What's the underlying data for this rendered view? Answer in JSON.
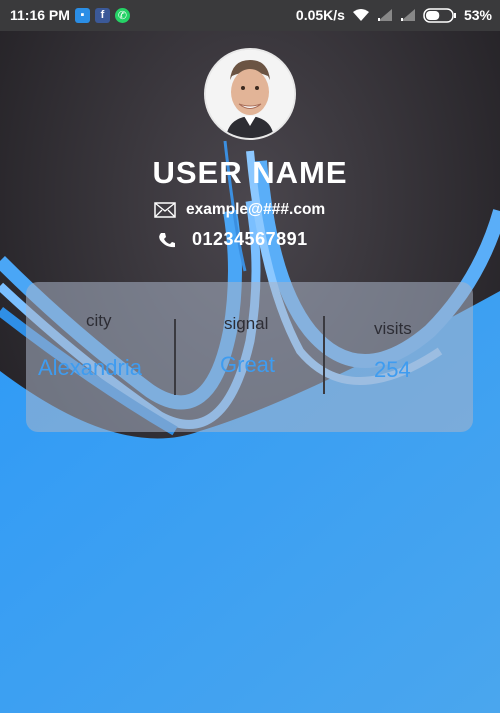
{
  "status_bar": {
    "time": "11:16 PM",
    "network_speed": "0.05K/s",
    "battery": "53%",
    "battery_level": 0.53,
    "icons": [
      "file-icon",
      "facebook-icon",
      "whatsapp-icon",
      "wifi-icon",
      "signal-icon",
      "signal-icon",
      "battery-icon"
    ]
  },
  "profile": {
    "name": "USER NAME",
    "email": "example@###.com",
    "phone": "01234567891"
  },
  "stats": [
    {
      "label": "city",
      "value": "Alexandria"
    },
    {
      "label": "signal",
      "value": "Great"
    },
    {
      "label": "visits",
      "value": "254"
    }
  ],
  "colors": {
    "accent": "#3e9cf0",
    "dark_bg": "#2a2a2f",
    "blue_bg": "#3aa0f5"
  }
}
